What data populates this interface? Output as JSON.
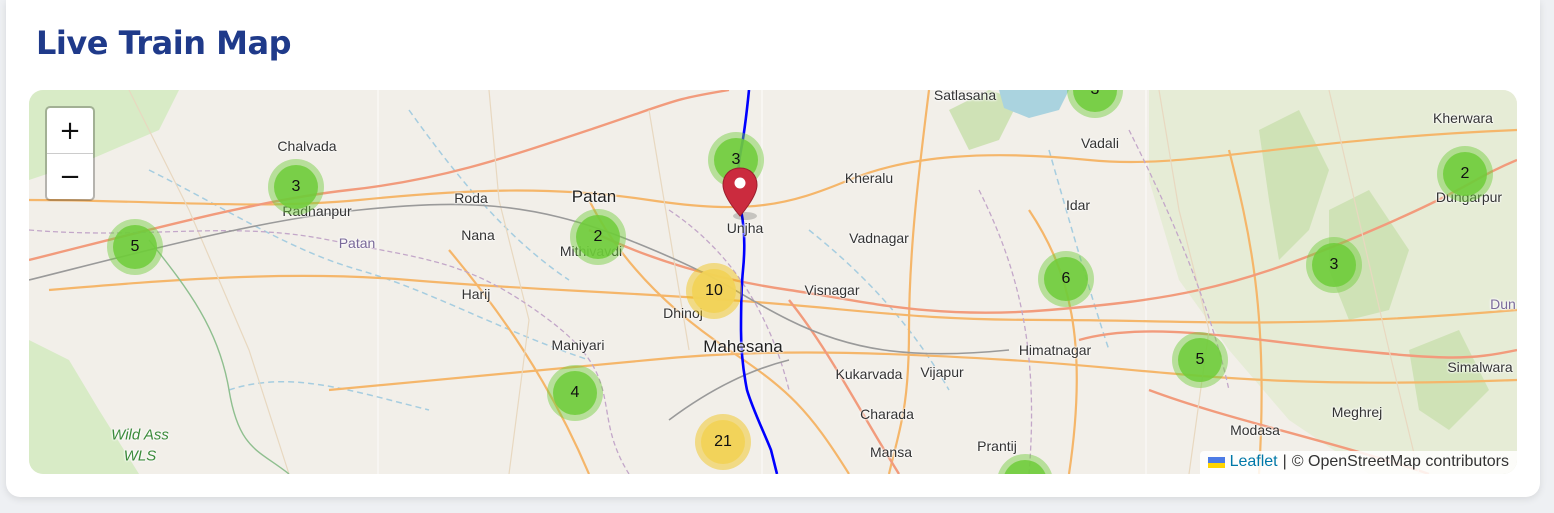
{
  "page": {
    "title": "Live Train Map"
  },
  "map": {
    "zoom_controls": {
      "zoom_in": "+",
      "zoom_out": "−"
    },
    "attribution": {
      "link_text": "Leaflet",
      "separator": "|",
      "credit": "© OpenStreetMap contributors"
    },
    "places": [
      {
        "key": "satlasana",
        "label": "Satlasana"
      },
      {
        "key": "chalvada",
        "label": "Chalvada"
      },
      {
        "key": "kherwara",
        "label": "Kherwara"
      },
      {
        "key": "vadali",
        "label": "Vadali"
      },
      {
        "key": "patan",
        "label": "Patan"
      },
      {
        "key": "roda",
        "label": "Roda"
      },
      {
        "key": "radhanpur",
        "label": "Radhanpur"
      },
      {
        "key": "kheralu",
        "label": "Kheralu"
      },
      {
        "key": "idar",
        "label": "Idar"
      },
      {
        "key": "dungarpur",
        "label": "Dungarpur"
      },
      {
        "key": "nana",
        "label": "Nana"
      },
      {
        "key": "patan_district",
        "label": "Patan"
      },
      {
        "key": "mithivavdi",
        "label": "Mithivavdi"
      },
      {
        "key": "unjha",
        "label": "Unjha"
      },
      {
        "key": "vadnagar",
        "label": "Vadnagar"
      },
      {
        "key": "harij",
        "label": "Harij"
      },
      {
        "key": "visnagar",
        "label": "Visnagar"
      },
      {
        "key": "dhinoj",
        "label": "Dhinoj"
      },
      {
        "key": "maniyari",
        "label": "Maniyari"
      },
      {
        "key": "mahesana",
        "label": "Mahesana"
      },
      {
        "key": "himatnagar",
        "label": "Himatnagar"
      },
      {
        "key": "kukarvada",
        "label": "Kukarvada"
      },
      {
        "key": "vijapur",
        "label": "Vijapur"
      },
      {
        "key": "simalwara",
        "label": "Simalwara"
      },
      {
        "key": "charada",
        "label": "Charada"
      },
      {
        "key": "meghrej",
        "label": "Meghrej"
      },
      {
        "key": "modasa",
        "label": "Modasa"
      },
      {
        "key": "wild_ass",
        "label": "Wild Ass"
      },
      {
        "key": "wls",
        "label": "WLS"
      },
      {
        "key": "prantij",
        "label": "Prantij"
      },
      {
        "key": "mansa",
        "label": "Mansa"
      },
      {
        "key": "dung",
        "label": "Dun"
      }
    ],
    "clusters": [
      {
        "key": "c_top_right",
        "count": "3",
        "size": "small"
      },
      {
        "key": "c_sidhpur",
        "count": "3",
        "size": "small"
      },
      {
        "key": "c_radhanpur",
        "count": "3",
        "size": "small"
      },
      {
        "key": "c_dungarpur",
        "count": "2",
        "size": "small"
      },
      {
        "key": "c_west",
        "count": "5",
        "size": "small"
      },
      {
        "key": "c_mithivavdi",
        "count": "2",
        "size": "small"
      },
      {
        "key": "c_east",
        "count": "3",
        "size": "small"
      },
      {
        "key": "c_idar",
        "count": "6",
        "size": "small"
      },
      {
        "key": "c_dhinoj",
        "count": "10",
        "size": "medium"
      },
      {
        "key": "c_modasa",
        "count": "5",
        "size": "small"
      },
      {
        "key": "c_maniyari",
        "count": "4",
        "size": "small"
      },
      {
        "key": "c_south",
        "count": "21",
        "size": "medium"
      }
    ],
    "colors": {
      "route": "#0000ff",
      "marker": "#cb2b3e",
      "cluster_small": "#6ecc39",
      "cluster_medium": "#f1d357",
      "title": "#1f3a8a"
    }
  }
}
